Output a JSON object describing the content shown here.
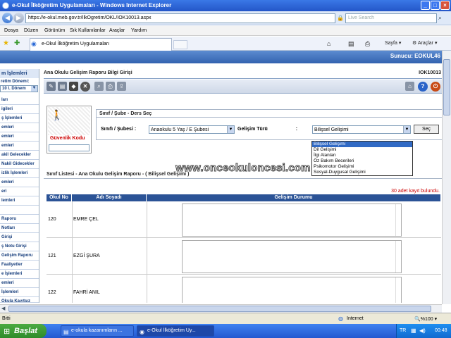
{
  "window": {
    "title": "e-Okul İlköğretim Uygulamaları - Windows Internet Explorer"
  },
  "address": {
    "url": "https://e-okul.meb.gov.tr/IlkOgretim/OKL/IOK10013.aspx",
    "search_placeholder": "Live Search"
  },
  "menu": [
    "Dosya",
    "Düzen",
    "Görünüm",
    "Sık Kullanılanlar",
    "Araçlar",
    "Yardım"
  ],
  "tab": {
    "label": "e-Okul İlköğretim Uygulamaları"
  },
  "ie_toolbar": {
    "page": "Sayfa",
    "tools": "Araçlar"
  },
  "server": "Sunucu: EOKUL46",
  "sidebar": {
    "header": "m İşlemleri",
    "term_label": "retim Dönemi:",
    "term_value": "10 I. Dönem",
    "items": [
      "ları",
      "igileri",
      "ş İşlemleri",
      "emleri",
      "emleri",
      "emleri",
      "akil Gelecekler",
      "Nakil Gidecekler",
      "izlik İşlemleri",
      "emleri",
      "eri",
      "lemleri",
      "",
      "Raporu",
      "Notları",
      "Girişi",
      "ş Notu Girişi",
      "Gelişim Raporu",
      "Faaliyetler",
      "e İşlemleri",
      "emleri",
      "İşlemleri",
      "Okula Kayıtsız"
    ]
  },
  "page": {
    "title": "Ana Okulu Gelişim Raporu Bilgi Girişi",
    "code": "IOK10013"
  },
  "captcha": {
    "label": "Güvenlik Kodu"
  },
  "filter": {
    "header": "Sınıf / Şube  - Ders Seç",
    "class_label": "Sınıfı / Şubesi",
    "class_value": "Anaokulu 5 Yaş / E Şubesi",
    "dev_label": "Gelişim Türü",
    "dev_value": "Bilişsel Gelişimi",
    "button": "Seç",
    "options": [
      "Bilişsel Gelişimi",
      "Dil Gelişimi",
      "İlgi Alanları",
      "Öz Bakım Becerileri",
      "Psikomotor Gelişimi",
      "Sosyal-Duygusal Gelişimi"
    ]
  },
  "watermark": "www.onceokuloncesi.com",
  "list": {
    "header": "Sınıf Listesi - Ana Okulu Gelişim Raporu - ( Bilişsel Gelişimi )",
    "count": "30 adet kayıt bulundu.",
    "columns": [
      "Okul No",
      "Adı Soyadı",
      "Gelişim Durumu"
    ],
    "rows": [
      {
        "no": "120",
        "name": "EMRE ÇEL"
      },
      {
        "no": "121",
        "name": "EZGİ ŞURA"
      },
      {
        "no": "122",
        "name": "FAHRİ ANIL"
      }
    ]
  },
  "status": {
    "text": "Bitti",
    "zone": "Internet",
    "zoom": "%100"
  },
  "taskbar": {
    "start": "Başlat",
    "tasks": [
      "e-okula kazanımların ...",
      "e-Okul İlköğretim Uy..."
    ],
    "lang": "TR",
    "clock": "00:48"
  }
}
